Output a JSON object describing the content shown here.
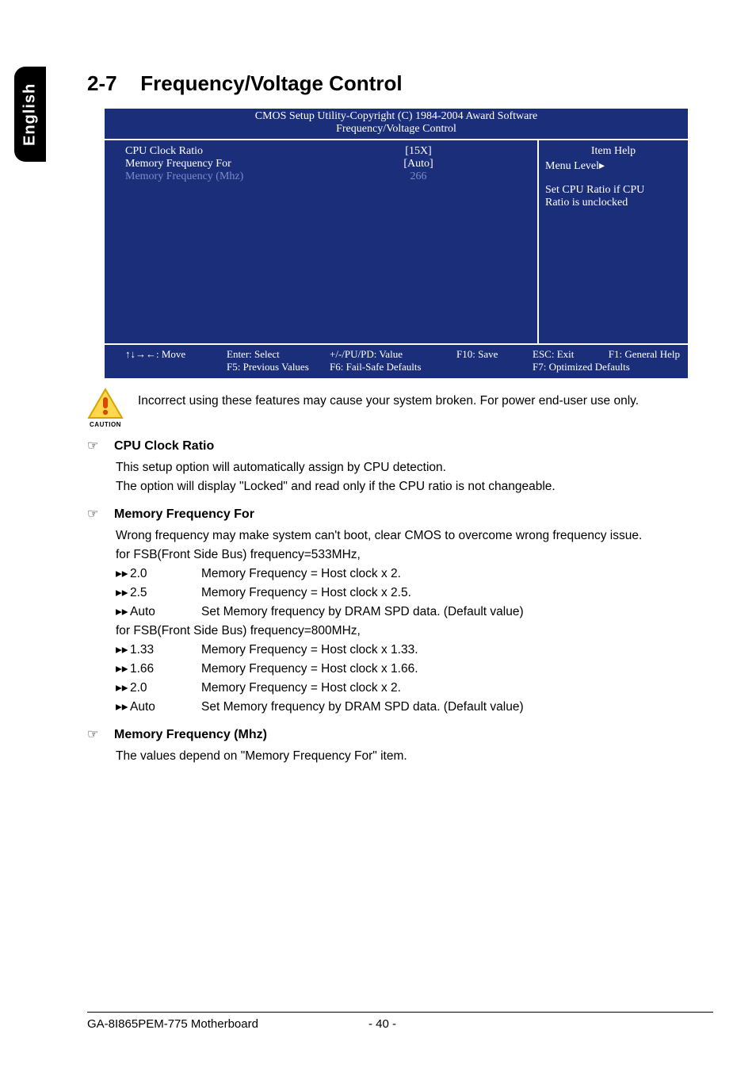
{
  "side_tab": "English",
  "section": {
    "num": "2-7",
    "title": "Frequency/Voltage Control"
  },
  "bios": {
    "header_line1": "CMOS Setup Utility-Copyright (C) 1984-2004 Award Software",
    "header_line2": "Frequency/Voltage Control",
    "rows": [
      {
        "label": "CPU Clock Ratio",
        "value": "[15X]",
        "dim": false
      },
      {
        "label": "Memory Frequency For",
        "value": "[Auto]",
        "dim": false
      },
      {
        "label": "Memory Frequency (Mhz)",
        "value": "266",
        "dim": true
      }
    ],
    "help": {
      "title": "Item Help",
      "menu_level": "Menu Level▸",
      "text1": "Set CPU Ratio if CPU",
      "text2": "Ratio is unclocked"
    },
    "footer": {
      "r1c1": "↑↓→←: Move",
      "r1c2": "Enter: Select",
      "r1c3": "+/-/PU/PD: Value",
      "r1c4": "F10: Save",
      "r1c5": "ESC: Exit",
      "r1c6": "F1: General Help",
      "r2c2": "F5: Previous Values",
      "r2c3": "F6: Fail-Safe Defaults",
      "r2c5": "F7: Optimized Defaults"
    }
  },
  "caution": {
    "label": "CAUTION",
    "text": "Incorrect using these features may cause your system broken. For power end-user use only."
  },
  "options": [
    {
      "title": "CPU Clock Ratio",
      "lines": [
        "This setup option will automatically assign by CPU detection.",
        "The option will display \"Locked\" and read only if the CPU ratio is not changeable."
      ]
    },
    {
      "title": "Memory Frequency For",
      "lines": [
        "Wrong frequency may make system can't boot, clear CMOS to overcome wrong frequency issue.",
        "for FSB(Front Side Bus) frequency=533MHz,"
      ],
      "values": [
        {
          "k": "2.0",
          "v": "Memory Frequency = Host clock x 2."
        },
        {
          "k": "2.5",
          "v": "Memory Frequency = Host clock x 2.5."
        },
        {
          "k": "Auto",
          "v": "Set Memory frequency by DRAM SPD data. (Default value)"
        }
      ],
      "lines2": [
        "for FSB(Front Side Bus) frequency=800MHz,"
      ],
      "values2": [
        {
          "k": "1.33",
          "v": "Memory Frequency = Host clock x 1.33."
        },
        {
          "k": "1.66",
          "v": "Memory Frequency = Host clock x 1.66."
        },
        {
          "k": "2.0",
          "v": "Memory Frequency = Host clock x 2."
        },
        {
          "k": "Auto",
          "v": "Set Memory frequency by DRAM SPD data. (Default value)"
        }
      ]
    },
    {
      "title": "Memory Frequency (Mhz)",
      "lines": [
        "The values depend on \"Memory Frequency For\" item."
      ]
    }
  ],
  "footer": {
    "left": "GA-8I865PEM-775 Motherboard",
    "page": "- 40 -"
  },
  "glyphs": {
    "hand": "☞",
    "darrow": "▸▸"
  }
}
